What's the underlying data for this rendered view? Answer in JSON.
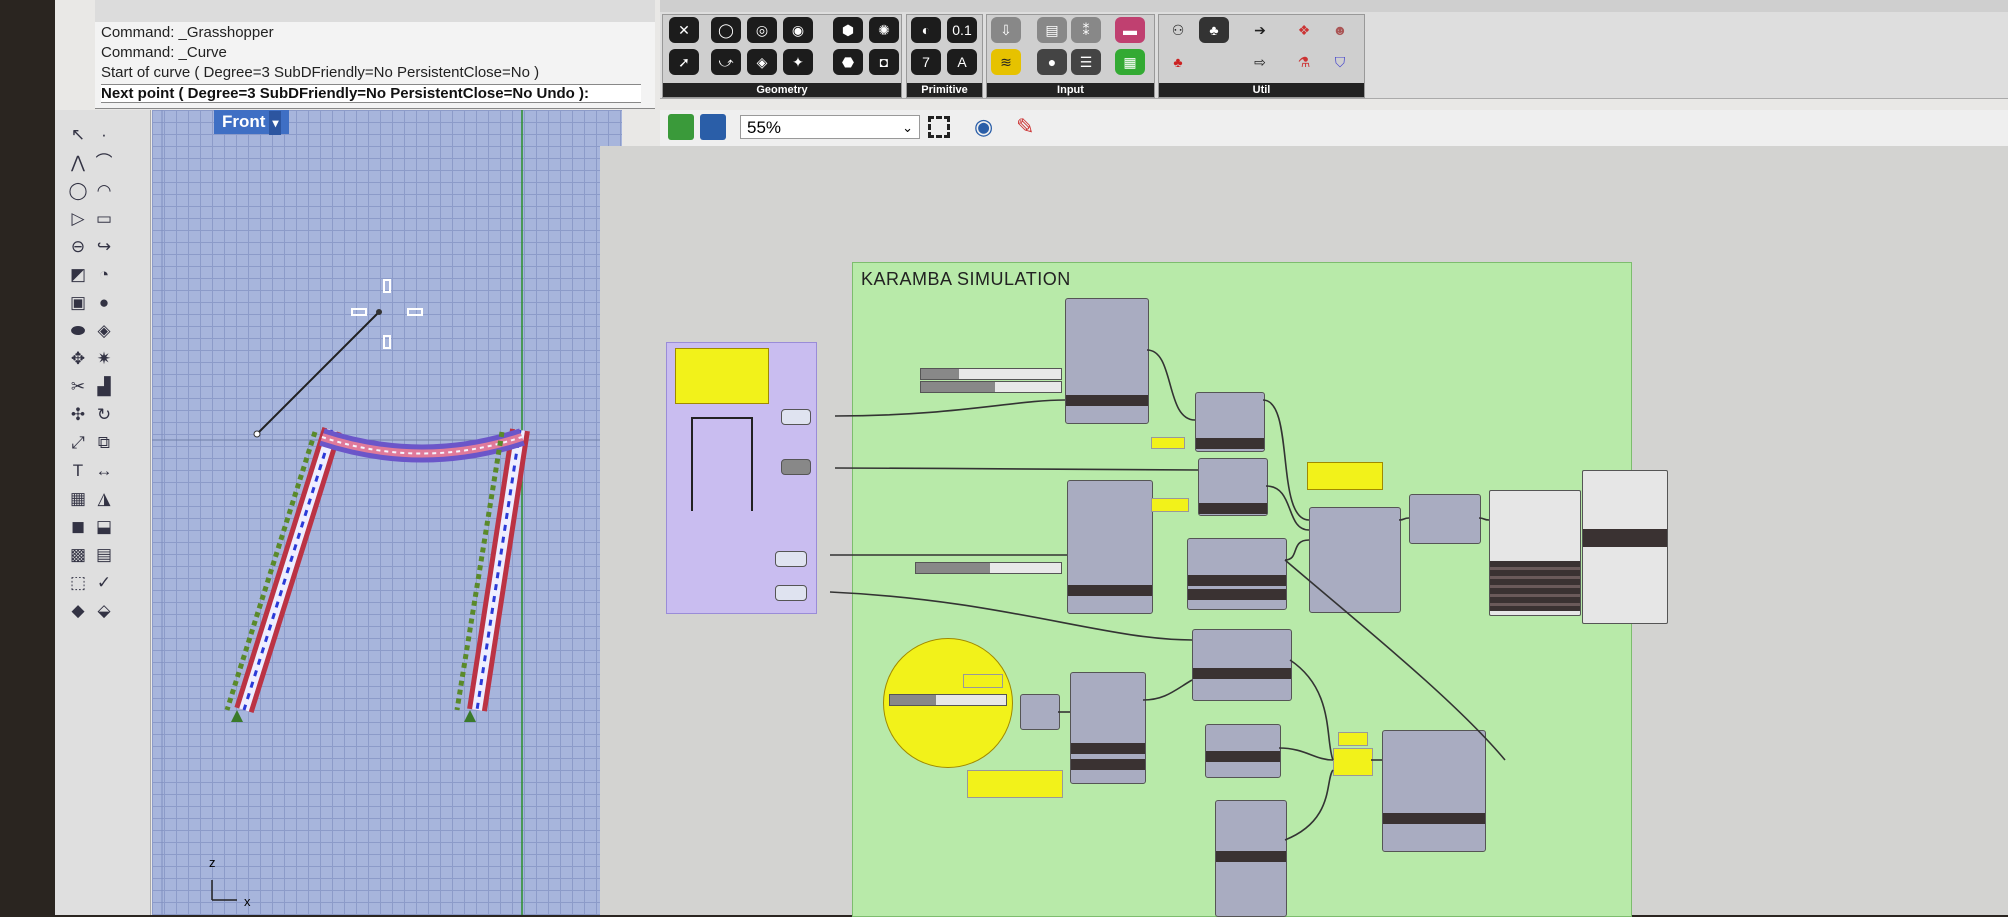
{
  "command_history": [
    "Command: _Grasshopper",
    "Command: _Curve",
    "Start of curve ( Degree=3  SubDFriendly=No  PersistentClose=No )"
  ],
  "command_prompt": "Next point ( Degree=3  SubDFriendly=No  PersistentClose=No  Undo ):",
  "viewport": {
    "title": "Front",
    "axis_z": "z",
    "axis_x": "x"
  },
  "gh_ribbon": {
    "groups": [
      {
        "label": "Geometry",
        "icons": [
          "point-icon",
          "circle-icon",
          "curve-icon",
          "surface-icon",
          "mesh-icon",
          "vector-icon",
          "brep-icon",
          "geometry-icon"
        ]
      },
      {
        "label": "Primitive",
        "icons": [
          "0.1",
          "7",
          "A",
          "boolean"
        ]
      },
      {
        "label": "Input",
        "icons": [
          "panel",
          "slider",
          "toggle",
          "gradient"
        ]
      },
      {
        "label": "Util",
        "icons": [
          "cherry",
          "flask",
          "arrow"
        ]
      }
    ],
    "primitive_labels": [
      "0.1",
      "7",
      "A"
    ]
  },
  "gh_toolbar": {
    "zoom": "55%"
  },
  "canvas": {
    "group_title": "KARAMBA SIMULATION"
  },
  "colors": {
    "group_green": "#b8eaa9",
    "group_purple": "#c9bdf0",
    "viewport_bg": "#a7b5dc",
    "panel_yellow": "#f2f21a",
    "title_blue": "#3f6fc4"
  }
}
